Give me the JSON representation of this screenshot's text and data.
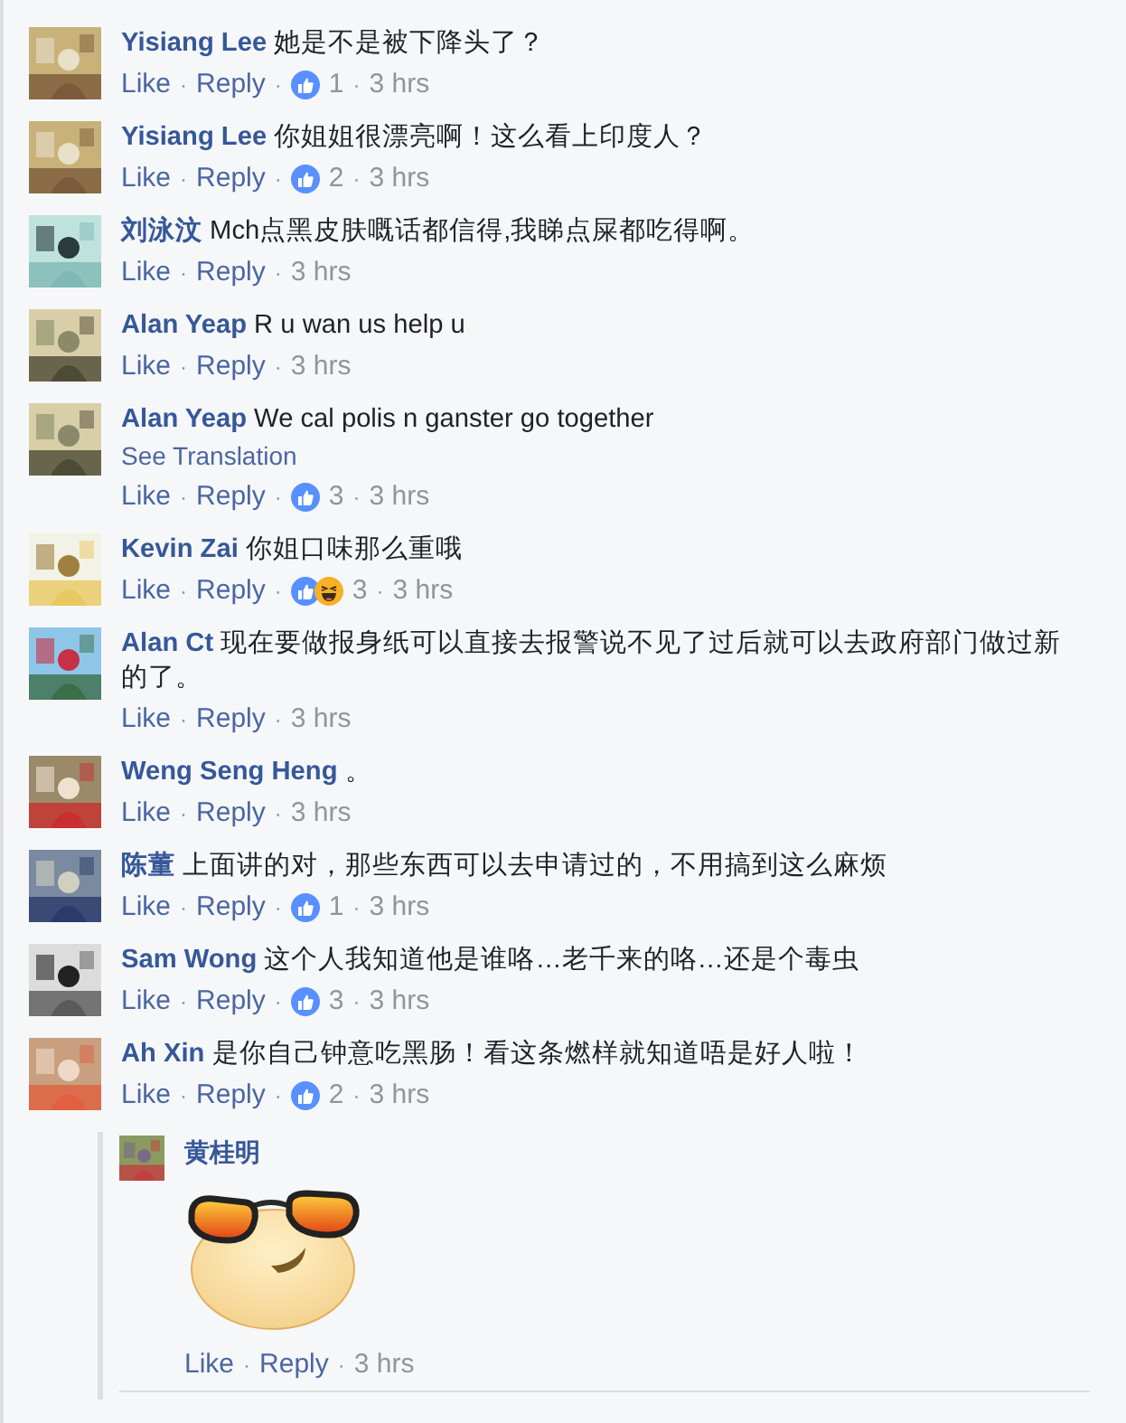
{
  "separator": "·",
  "comments": [
    {
      "author": "Yisiang Lee",
      "text": "她是不是被下降头了？",
      "actions": [
        "Like",
        "Reply"
      ],
      "reactions": [
        {
          "kind": "like"
        }
      ],
      "reaction_count": "1",
      "time": "3 hrs"
    },
    {
      "author": "Yisiang Lee",
      "text": "你姐姐很漂亮啊！这么看上印度人？",
      "actions": [
        "Like",
        "Reply"
      ],
      "reactions": [
        {
          "kind": "like"
        }
      ],
      "reaction_count": "2",
      "time": "3 hrs"
    },
    {
      "author": "刘泳汶",
      "text": "Mch点黑皮肤嘅话都信得,我睇点屎都吃得啊。",
      "actions": [
        "Like",
        "Reply"
      ],
      "time": "3 hrs"
    },
    {
      "author": "Alan Yeap",
      "text": "R u wan us help u",
      "actions": [
        "Like",
        "Reply"
      ],
      "time": "3 hrs"
    },
    {
      "author": "Alan Yeap",
      "text": "We cal polis n ganster go together",
      "see_translation": "See Translation",
      "actions": [
        "Like",
        "Reply"
      ],
      "reactions": [
        {
          "kind": "like"
        }
      ],
      "reaction_count": "3",
      "time": "3 hrs"
    },
    {
      "author": "Kevin Zai",
      "text": "你姐口味那么重哦",
      "actions": [
        "Like",
        "Reply"
      ],
      "reactions": [
        {
          "kind": "like"
        },
        {
          "kind": "haha"
        }
      ],
      "reaction_count": "3",
      "time": "3 hrs"
    },
    {
      "author": "Alan Ct",
      "text": "现在要做报身纸可以直接去报警说不见了过后就可以去政府部门做过新的了。",
      "actions": [
        "Like",
        "Reply"
      ],
      "time": "3 hrs"
    },
    {
      "author": "Weng Seng Heng",
      "text": "。",
      "actions": [
        "Like",
        "Reply"
      ],
      "time": "3 hrs"
    },
    {
      "author": "陈董",
      "text": "上面讲的对，那些东西可以去申请过的，不用搞到这么麻烦",
      "actions": [
        "Like",
        "Reply"
      ],
      "reactions": [
        {
          "kind": "like"
        }
      ],
      "reaction_count": "1",
      "time": "3 hrs"
    },
    {
      "author": "Sam Wong",
      "text": "这个人我知道他是谁咯…老千来的咯…还是个毒虫",
      "actions": [
        "Like",
        "Reply"
      ],
      "reactions": [
        {
          "kind": "like"
        }
      ],
      "reaction_count": "3",
      "time": "3 hrs"
    },
    {
      "author": "Ah Xin",
      "text": "是你自己钟意吃黑肠！看这条燃样就知道唔是好人啦！",
      "actions": [
        "Like",
        "Reply"
      ],
      "reactions": [
        {
          "kind": "like"
        }
      ],
      "reaction_count": "2",
      "time": "3 hrs",
      "replies": [
        {
          "author": "黄桂明",
          "sticker": {
            "kind": "sunglasses"
          },
          "actions": [
            "Like",
            "Reply"
          ],
          "time": "3 hrs"
        }
      ]
    }
  ]
}
